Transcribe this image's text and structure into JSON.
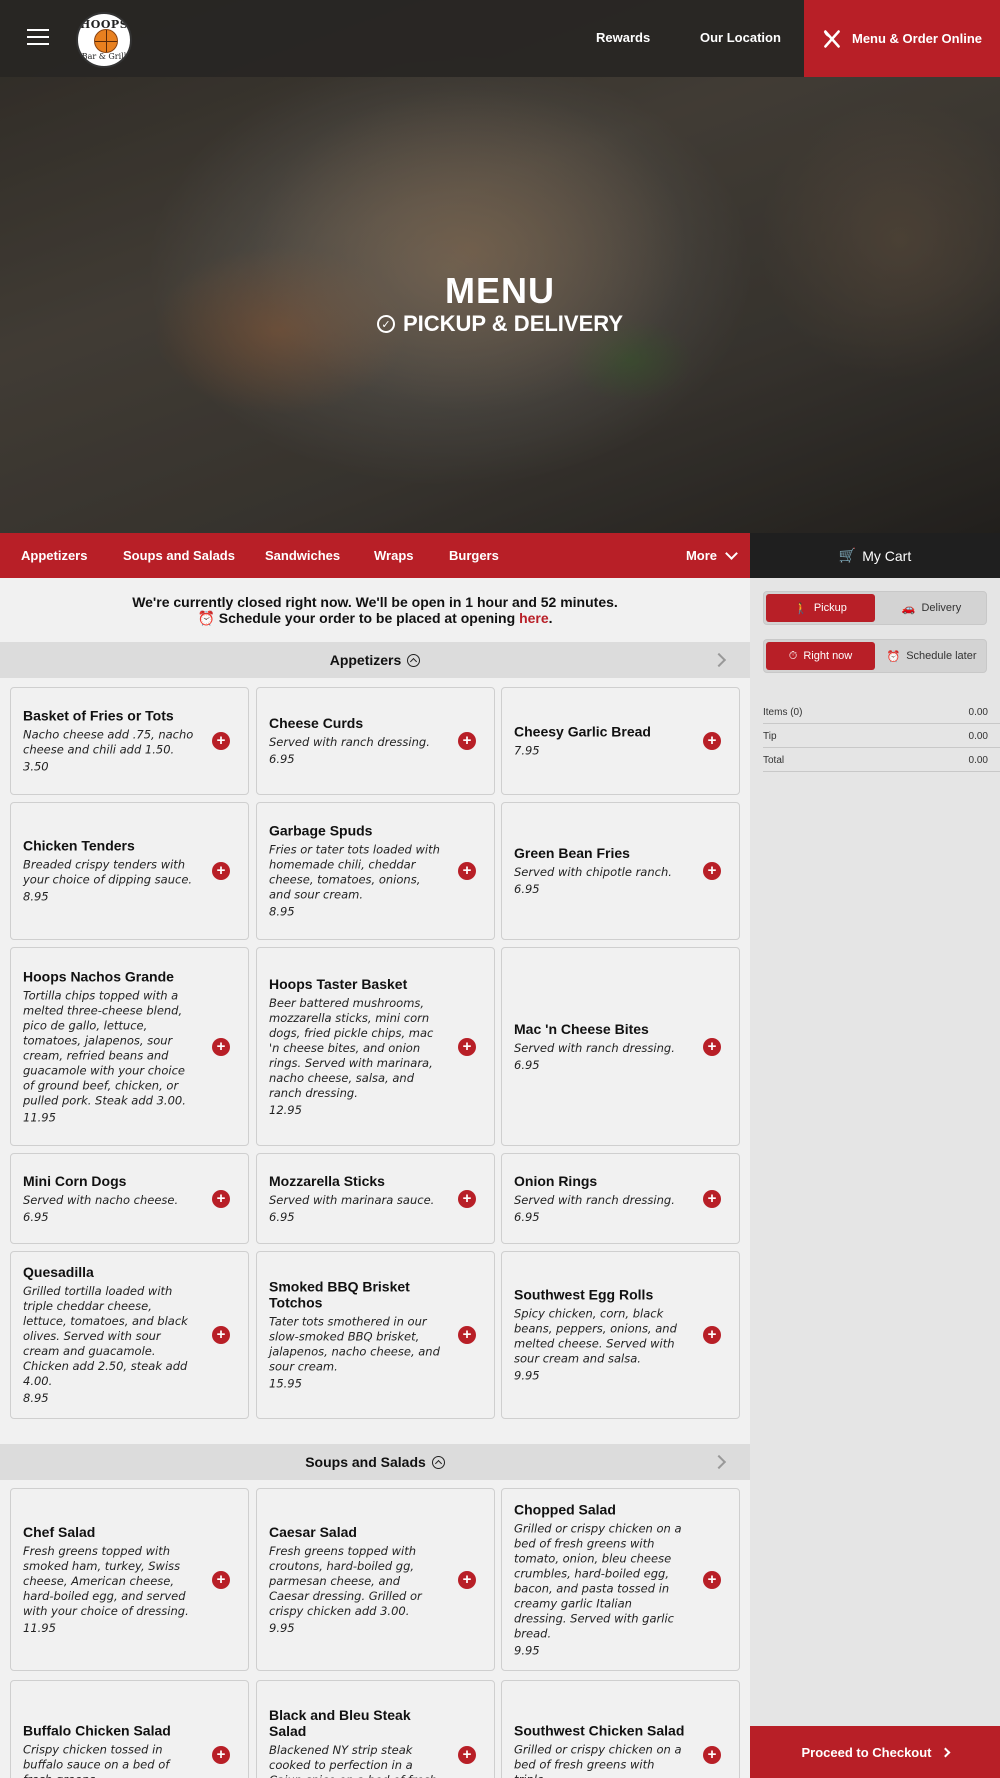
{
  "header": {
    "logo_top": "HOOPS",
    "logo_bottom": "Bar & Grill",
    "nav_rewards": "Rewards",
    "nav_location": "Our Location",
    "order_online": "Menu & Order Online"
  },
  "hero": {
    "title": "MENU",
    "subtitle": "PICKUP & DELIVERY"
  },
  "categories": [
    "Appetizers",
    "Soups and Salads",
    "Sandwiches",
    "Wraps",
    "Burgers"
  ],
  "more_label": "More",
  "notice": {
    "line1": "We're currently closed right now. We'll be open in 1 hour and 52 minutes.",
    "line2": "Schedule your order to be placed at opening ",
    "link": "here",
    "period": "."
  },
  "sections": {
    "appetizers": {
      "title": "Appetizers",
      "items": [
        {
          "name": "Basket of Fries or Tots",
          "desc": "Nacho cheese add .75, nacho cheese and chili add 1.50.",
          "price": "3.50"
        },
        {
          "name": "Cheese Curds",
          "desc": "Served with ranch dressing.",
          "price": "6.95"
        },
        {
          "name": "Cheesy Garlic Bread",
          "desc": "",
          "price": "7.95"
        },
        {
          "name": "Chicken Tenders",
          "desc": "Breaded crispy tenders with your choice of dipping sauce.",
          "price": "8.95"
        },
        {
          "name": "Garbage Spuds",
          "desc": "Fries or tater tots loaded with homemade chili, cheddar cheese, tomatoes, onions, and sour cream.",
          "price": "8.95"
        },
        {
          "name": "Green Bean Fries",
          "desc": "Served with chipotle ranch.",
          "price": "6.95"
        },
        {
          "name": "Hoops Nachos Grande",
          "desc": "Tortilla chips topped with a melted three-cheese blend, pico de gallo, lettuce, tomatoes, jalapenos, sour cream, refried beans and guacamole with your choice of ground beef, chicken, or pulled pork. Steak add 3.00.",
          "price": "11.95"
        },
        {
          "name": "Hoops Taster Basket",
          "desc": "Beer battered mushrooms, mozzarella sticks, mini corn dogs, fried pickle chips, mac 'n cheese bites, and onion rings. Served with marinara, nacho cheese, salsa, and ranch dressing.",
          "price": "12.95"
        },
        {
          "name": "Mac 'n Cheese Bites",
          "desc": "Served with ranch dressing.",
          "price": "6.95"
        },
        {
          "name": "Mini Corn Dogs",
          "desc": "Served with nacho cheese.",
          "price": "6.95"
        },
        {
          "name": "Mozzarella Sticks",
          "desc": "Served with marinara sauce.",
          "price": "6.95"
        },
        {
          "name": "Onion Rings",
          "desc": "Served with ranch dressing.",
          "price": "6.95"
        },
        {
          "name": "Quesadilla",
          "desc": "Grilled tortilla loaded with triple cheddar cheese, lettuce, tomatoes, and black olives. Served with sour cream and guacamole. Chicken add 2.50, steak add 4.00.",
          "price": "8.95"
        },
        {
          "name": "Smoked BBQ Brisket Totchos",
          "desc": "Tater tots smothered in our slow-smoked BBQ brisket, jalapenos, nacho cheese, and sour cream.",
          "price": "15.95"
        },
        {
          "name": "Southwest Egg Rolls",
          "desc": "Spicy chicken, corn, black beans, peppers, onions, and melted cheese. Served with sour cream and salsa.",
          "price": "9.95"
        }
      ]
    },
    "soups": {
      "title": "Soups and Salads",
      "items": [
        {
          "name": "Chef Salad",
          "desc": "Fresh greens topped with smoked ham, turkey, Swiss cheese, American cheese, hard-boiled egg, and served with your choice of dressing.",
          "price": "11.95"
        },
        {
          "name": "Caesar Salad",
          "desc": "Fresh greens topped with croutons, hard-boiled gg, parmesan cheese, and Caesar dressing. Grilled or crispy chicken add 3.00.",
          "price": "9.95"
        },
        {
          "name": "Chopped Salad",
          "desc": "Grilled or crispy chicken on a bed of fresh greens with tomato, onion, bleu cheese crumbles, hard-boiled egg, bacon, and pasta tossed in creamy garlic Italian dressing. Served with garlic bread.",
          "price": "9.95"
        },
        {
          "name": "Buffalo Chicken Salad",
          "desc": "Crispy chicken tossed in buffalo sauce on a bed of fresh greens",
          "price": ""
        },
        {
          "name": "Black and Bleu Steak Salad",
          "desc": "Blackened NY strip steak cooked to perfection in a Cajun spice on a bed of fresh greens",
          "price": ""
        },
        {
          "name": "Southwest Chicken Salad",
          "desc": "Grilled or crispy chicken on a bed of fresh greens with triple",
          "price": ""
        }
      ]
    }
  },
  "cart": {
    "title": "My Cart",
    "pickup": "Pickup",
    "delivery": "Delivery",
    "right_now": "Right now",
    "schedule_later": "Schedule later",
    "items_label": "Items (0)",
    "items_value": "0.00",
    "tip_label": "Tip",
    "tip_value": "0.00",
    "total_label": "Total",
    "total_value": "0.00",
    "checkout": "Proceed to Checkout"
  },
  "colors": {
    "brand_red": "#b81f27",
    "dark": "#1f1f1f"
  }
}
